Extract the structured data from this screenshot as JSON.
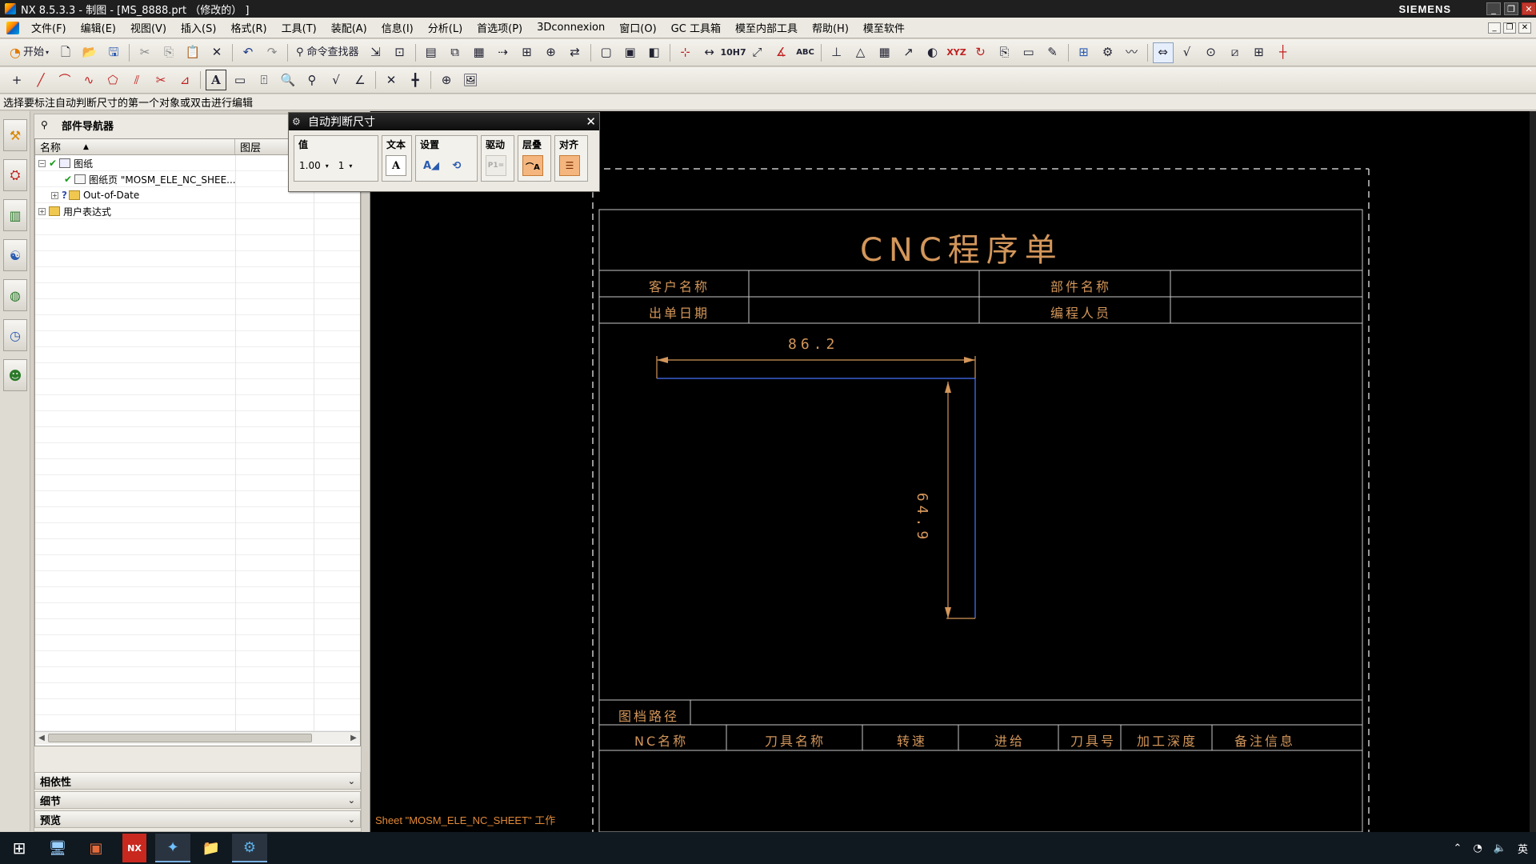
{
  "window": {
    "title": "NX 8.5.3.3 - 制图 - [MS_8888.prt （修改的） ]",
    "brand": "SIEMENS"
  },
  "menu": {
    "items": [
      "文件(F)",
      "编辑(E)",
      "视图(V)",
      "插入(S)",
      "格式(R)",
      "工具(T)",
      "装配(A)",
      "信息(I)",
      "分析(L)",
      "首选项(P)",
      "3Dconnexion",
      "窗口(O)",
      "GC 工具箱",
      "模至内部工具",
      "帮助(H)",
      "模至软件"
    ]
  },
  "toolbar1": {
    "start_label": "开始",
    "command_finder_label": "命令查找器",
    "text_xyz": "XYZ",
    "text_abc": "ABC",
    "text_10h7": "10H7"
  },
  "cueline": {
    "text": "选择要标注自动判断尺寸的第一个对象或双击进行编辑"
  },
  "part_navigator": {
    "title": "部件导航器",
    "columns": [
      "名称",
      "图层"
    ],
    "rows": [
      {
        "label": "图纸",
        "level": 0
      },
      {
        "label": "图纸页 \"MOSM_ELE_NC_SHEE...",
        "level": 1
      },
      {
        "label": "Out-of-Date",
        "level": 1
      },
      {
        "label": "用户表达式",
        "level": 0
      }
    ],
    "panels": [
      "相依性",
      "细节",
      "预览"
    ]
  },
  "dialog": {
    "title": "自动判断尺寸",
    "groups": {
      "value": {
        "label": "值",
        "precision": "1.00",
        "tolerance": "1"
      },
      "text": {
        "label": "文本"
      },
      "settings": {
        "label": "设置"
      },
      "driving": {
        "label": "驱动",
        "icon_text": "P1="
      },
      "stack": {
        "label": "层叠"
      },
      "align": {
        "label": "对齐"
      }
    }
  },
  "drawing": {
    "title": "CNC程序单",
    "header_cells": [
      "客户名称",
      "部件名称",
      "出单日期",
      "编程人员"
    ],
    "dim_horizontal": "86.2",
    "dim_vertical": "64.9",
    "path_label": "图档路径",
    "table_columns": [
      "NC名称",
      "刀具名称",
      "转速",
      "进给",
      "刀具号",
      "加工深度",
      "备注信息"
    ],
    "sheet_status": "Sheet \"MOSM_ELE_NC_SHEET\" 工作"
  },
  "taskbar": {
    "tray_lang": "英"
  },
  "colors": {
    "drawing_orange": "#d3965a",
    "border_gray": "#c8c8c8",
    "geometry_blue": "#3a5fd0"
  }
}
